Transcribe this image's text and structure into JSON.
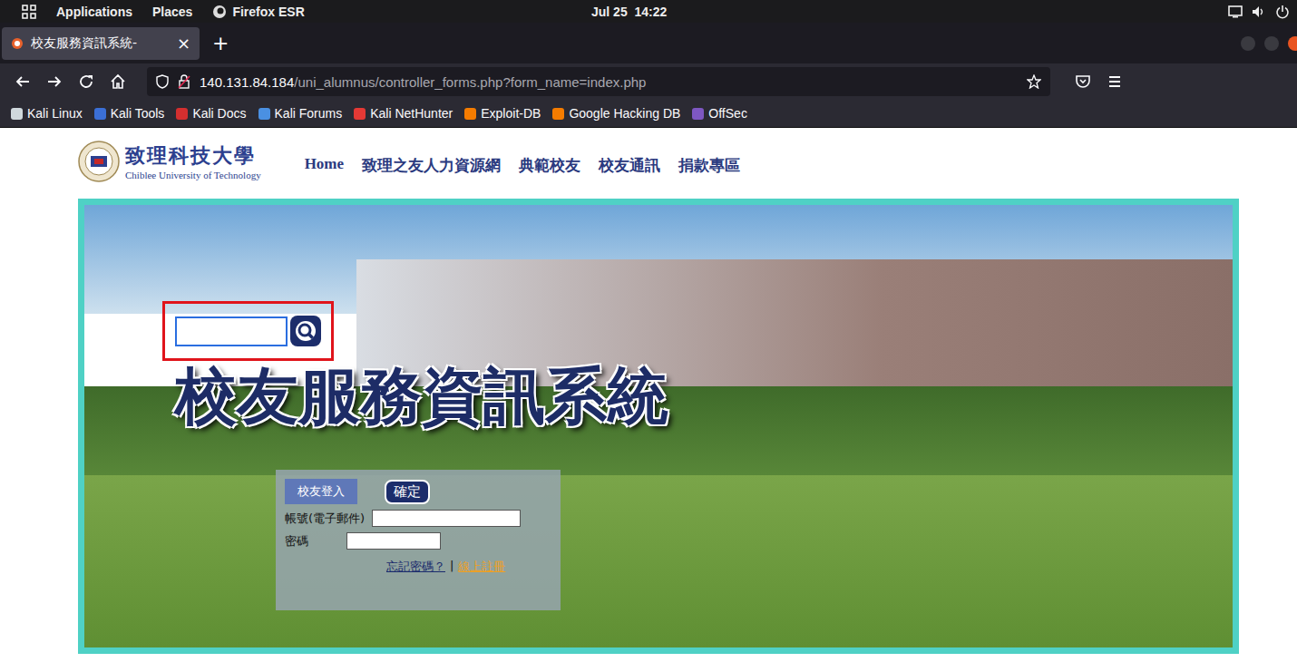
{
  "desktop_bar": {
    "menus": [
      "Applications",
      "Places"
    ],
    "app": "Firefox ESR",
    "clock": "Jul 25  14:22"
  },
  "tabs": [
    {
      "label": "校友服務資訊系統-",
      "selected": true,
      "close": "×"
    }
  ],
  "new_tab": "+",
  "url": {
    "host": "140.131.84.184",
    "path": "/uni_alumnus/controller_forms.php?form_name=index.php"
  },
  "bookmarks": [
    {
      "label": "Kali Linux",
      "color": "#cfd8dc"
    },
    {
      "label": "Kali Tools",
      "color": "#3b6fd6"
    },
    {
      "label": "Kali Docs",
      "color": "#d32f2f"
    },
    {
      "label": "Kali Forums",
      "color": "#4a90e2"
    },
    {
      "label": "Kali NetHunter",
      "color": "#e53935"
    },
    {
      "label": "Exploit-DB",
      "color": "#f57c00"
    },
    {
      "label": "Google Hacking DB",
      "color": "#f57c00"
    },
    {
      "label": "OffSec",
      "color": "#7e57c2"
    }
  ],
  "site": {
    "logo_name": "致理科技大學",
    "logo_subtitle": "Chiblee University of Technology",
    "nav": [
      "Home",
      "致理之友人力資源網",
      "典範校友",
      "校友通訊",
      "捐款專區"
    ]
  },
  "banner": {
    "title": "校友服務資訊系統",
    "search": {
      "value": "",
      "focused": true,
      "highlighted": true
    }
  },
  "login": {
    "tab": "校友登入",
    "submit": "確定",
    "fields": [
      {
        "label": "帳號(電子郵件)",
        "value": "",
        "kind": "email"
      },
      {
        "label": "密碼",
        "value": "",
        "kind": "password"
      }
    ],
    "links": [
      {
        "label": "忘記密碼？",
        "color": "#1a2a6c"
      },
      {
        "label": "線上註冊",
        "color": "#f0a020"
      }
    ],
    "separator": "|"
  }
}
